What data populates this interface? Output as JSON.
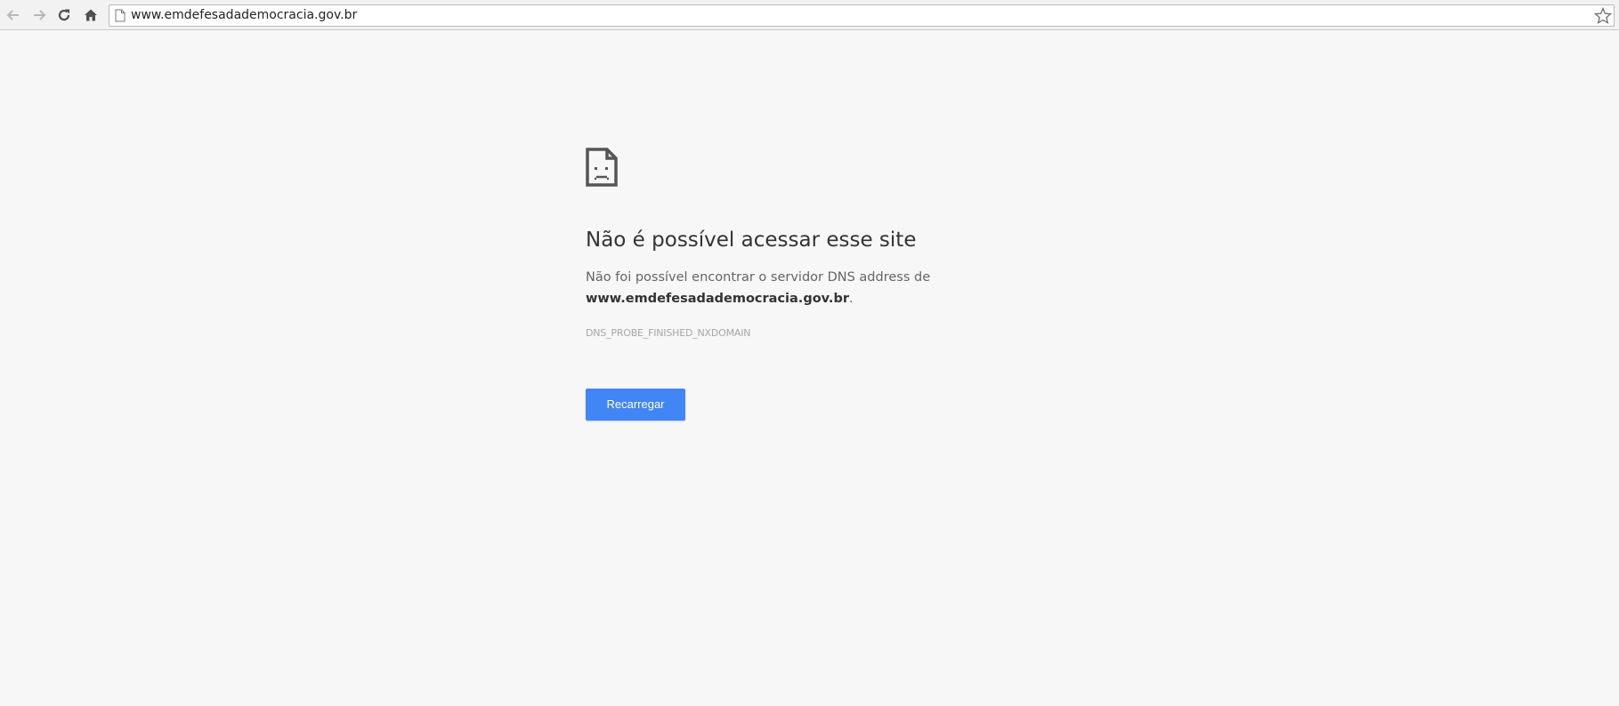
{
  "browser": {
    "nav": {
      "back_icon": "arrow-left-icon",
      "forward_icon": "arrow-right-icon",
      "reload_icon": "reload-icon",
      "home_icon": "home-icon"
    },
    "omnibox": {
      "page_icon": "page-icon",
      "url": "www.emdefesadademocracia.gov.br",
      "bookmark_icon": "star-icon"
    }
  },
  "error_page": {
    "icon": "sad-document-icon",
    "title": "Não é possível acessar esse site",
    "summary_prefix": "Não foi possível encontrar o servidor DNS address de",
    "summary_host": "www.emdefesadademocracia.gov.br",
    "summary_suffix": ".",
    "error_code": "DNS_PROBE_FINISHED_NXDOMAIN",
    "reload_label": "Recarregar"
  },
  "colors": {
    "page_background": "#f7f7f7",
    "button_blue": "#4285f4",
    "heading_text": "#333333",
    "body_text": "#646464",
    "error_code_text": "#a6a6a6"
  }
}
